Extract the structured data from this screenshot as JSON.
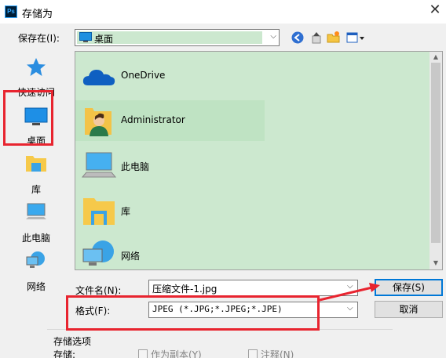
{
  "window": {
    "title": "存储为",
    "app_badge": "Ps",
    "close_glyph": "✕"
  },
  "toolbar": {
    "save_in_label": "保存在(I):",
    "location_value": "桌面",
    "combo_arrow": "⌵"
  },
  "places": [
    {
      "label": "快速访问",
      "icon": "star-icon"
    },
    {
      "label": "桌面",
      "icon": "desktop-icon"
    },
    {
      "label": "库",
      "icon": "library-icon"
    },
    {
      "label": "此电脑",
      "icon": "computer-icon"
    },
    {
      "label": "网络",
      "icon": "network-icon"
    }
  ],
  "file_list": {
    "items": [
      {
        "label": "OneDrive",
        "icon": "onedrive-icon"
      },
      {
        "label": "Administrator",
        "icon": "user-folder-icon"
      },
      {
        "label": "此电脑",
        "icon": "computer-icon"
      },
      {
        "label": "库",
        "icon": "library-icon"
      },
      {
        "label": "网络",
        "icon": "network-icon"
      }
    ],
    "scroll_up": "▲",
    "scroll_down": "▼"
  },
  "form": {
    "filename_label": "文件名(N):",
    "filename_value": "压缩文件-1.jpg",
    "format_label": "格式(F):",
    "format_value": "JPEG (*.JPG;*.JPEG;*.JPE)",
    "dropdown_arrow": "⌵"
  },
  "buttons": {
    "save": "保存(S)",
    "cancel": "取消"
  },
  "save_options": {
    "title": "存储选项",
    "store_label": "存储:",
    "as_copy": "作为副本(Y)",
    "notes": "注释(N)"
  },
  "colors": {
    "selection_bg": "#cce8cf",
    "annotation_red": "#e8242f",
    "accent_blue": "#0078d7"
  }
}
